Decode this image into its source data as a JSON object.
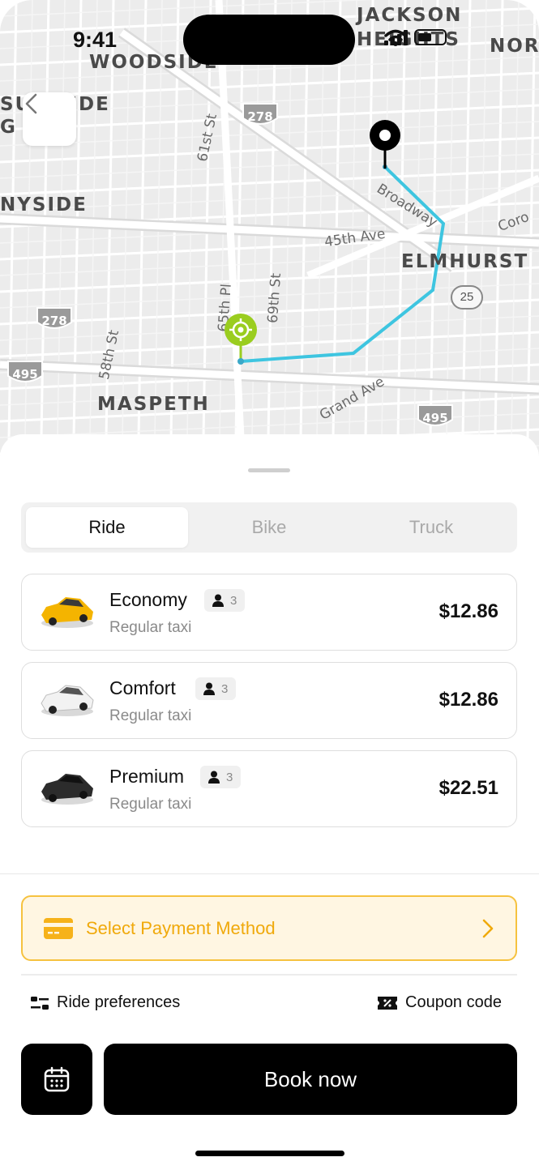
{
  "status_bar": {
    "time": "9:41"
  },
  "map": {
    "labels": {
      "woodside": "WOODSIDE",
      "jackson_heights_1": "JACKSON",
      "jackson_heights_2": "HEIGHTS",
      "north": "NOR",
      "sunnyside_gardens_1": "SU   YSIDE",
      "sunnyside_gardens_2": "G    ENS",
      "sunnyside": "NYSIDE",
      "elmhurst": "ELMHURST",
      "maspeth": "MASPETH",
      "st_61": "61st St",
      "st_58": "58th St",
      "pl_65": "65th Pl",
      "st_69": "69th St",
      "broadway": "Broadway",
      "ave_45": "45th Ave",
      "grand_ave": "Grand Ave",
      "corona": "Coro"
    },
    "shields": {
      "i278_a": "278",
      "i278_b": "278",
      "i495_a": "495",
      "i495_b": "495",
      "r25": "25"
    },
    "route_color": "#3ec5e0",
    "pickup_color": "#9acd1f"
  },
  "tabs": [
    {
      "label": "Ride",
      "active": true
    },
    {
      "label": "Bike",
      "active": false
    },
    {
      "label": "Truck",
      "active": false
    }
  ],
  "rides": [
    {
      "name": "Economy",
      "seats": "3",
      "subtitle": "Regular taxi",
      "price": "$12.86",
      "car_icon": "yellow-car-icon"
    },
    {
      "name": "Comfort",
      "seats": "3",
      "subtitle": "Regular taxi",
      "price": "$12.86",
      "car_icon": "white-car-icon"
    },
    {
      "name": "Premium",
      "seats": "3",
      "subtitle": "Regular taxi",
      "price": "$22.51",
      "car_icon": "black-car-icon"
    }
  ],
  "payment": {
    "label": "Select Payment Method",
    "accent": "#f0a90b"
  },
  "options": {
    "preferences": "Ride preferences",
    "coupon": "Coupon code"
  },
  "actions": {
    "book": "Book now"
  }
}
